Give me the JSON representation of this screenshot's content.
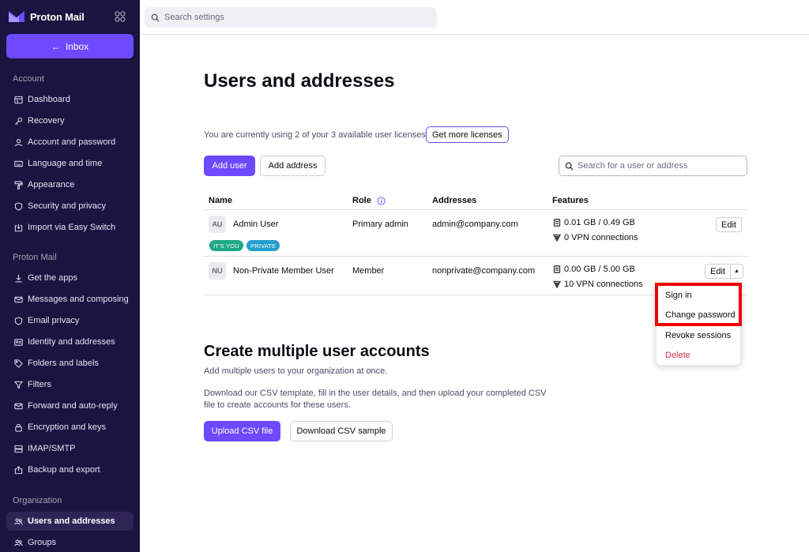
{
  "app": {
    "name": "Proton Mail",
    "brand_color": "#6d4aff"
  },
  "sidebar": {
    "inbox_label": "Inbox",
    "sections": {
      "account": "Account",
      "proton_mail": "Proton Mail",
      "organization": "Organization"
    },
    "items": [
      {
        "label": "Dashboard",
        "icon": "dashboard-icon"
      },
      {
        "label": "Recovery",
        "icon": "key-icon"
      },
      {
        "label": "Account and password",
        "icon": "user-icon"
      },
      {
        "label": "Language and time",
        "icon": "keyboard-icon"
      },
      {
        "label": "Appearance",
        "icon": "paint-roller-icon"
      },
      {
        "label": "Security and privacy",
        "icon": "shield-icon"
      },
      {
        "label": "Import via Easy Switch",
        "icon": "import-icon"
      },
      {
        "label": "Get the apps",
        "icon": "download-icon"
      },
      {
        "label": "Messages and composing",
        "icon": "envelope-icon"
      },
      {
        "label": "Email privacy",
        "icon": "shield-icon"
      },
      {
        "label": "Identity and addresses",
        "icon": "id-card-icon"
      },
      {
        "label": "Folders and labels",
        "icon": "tag-icon"
      },
      {
        "label": "Filters",
        "icon": "filter-icon"
      },
      {
        "label": "Forward and auto-reply",
        "icon": "forward-icon"
      },
      {
        "label": "Encryption and keys",
        "icon": "lock-icon"
      },
      {
        "label": "IMAP/SMTP",
        "icon": "server-icon"
      },
      {
        "label": "Backup and export",
        "icon": "export-icon"
      },
      {
        "label": "Users and addresses",
        "icon": "users-icon"
      },
      {
        "label": "Groups",
        "icon": "group-icon"
      }
    ]
  },
  "topbar": {
    "search_placeholder": "Search settings"
  },
  "main": {
    "title": "Users and addresses",
    "licenses_text": "You are currently using 2 of your 3 available user licenses.",
    "get_more_licenses": "Get more licenses",
    "add_user": "Add user",
    "add_address": "Add address",
    "user_search_placeholder": "Search for a user or address",
    "columns": [
      "Name",
      "Role",
      "Addresses",
      "Features"
    ],
    "users": [
      {
        "initials": "AU",
        "name": "Admin User",
        "role": "Primary admin",
        "address": "admin@company.com",
        "storage": "0.01 GB / 0.49 GB",
        "vpn": "0 VPN connections",
        "badges": [
          "IT'S YOU",
          "PRIVATE"
        ],
        "edit": "Edit"
      },
      {
        "initials": "NU",
        "name": "Non-Private Member User",
        "role": "Member",
        "address": "nonprivate@company.com",
        "storage": "0.00 GB / 5.00 GB",
        "vpn": "10 VPN connections",
        "edit": "Edit"
      }
    ],
    "dropdown": [
      "Sign in",
      "Change password",
      "Revoke sessions",
      "Delete"
    ],
    "create_title": "Create multiple user accounts",
    "create_sub": "Add multiple users to your organization at once.",
    "create_desc_1": "Download our CSV template, fill in the user details, and then upload your completed CSV",
    "create_desc_2": "file to create accounts for these users.",
    "upload_csv": "Upload CSV file",
    "download_csv": "Download CSV sample"
  },
  "colors": {
    "sidebar_bg": "#1b1340",
    "badge_you": "#1ea885",
    "badge_private": "#239ece",
    "danger": "#dc3251",
    "highlight": "#f00000"
  }
}
